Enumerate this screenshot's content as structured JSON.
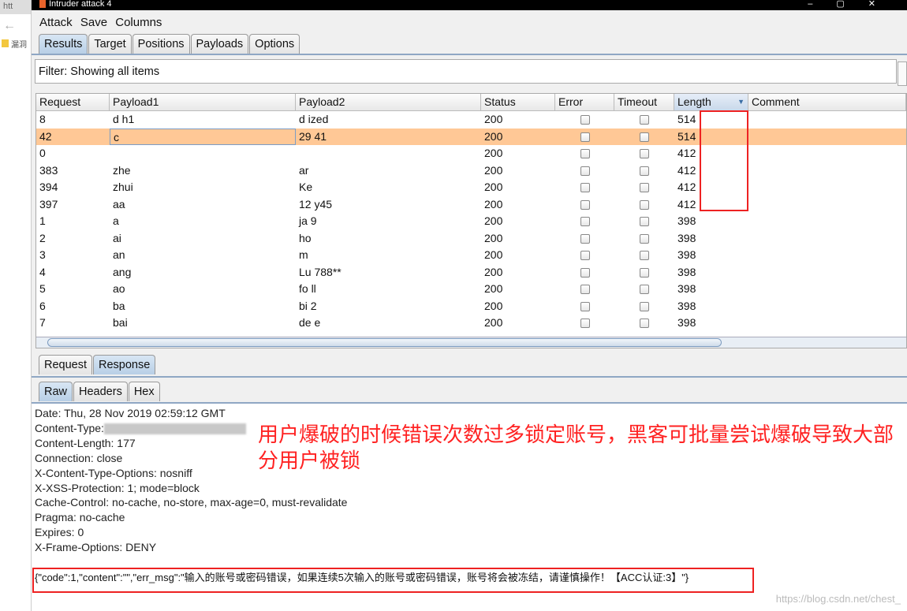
{
  "browser": {
    "tab_text": "htt",
    "bookmark": "漏洞"
  },
  "window": {
    "title": "Intruder attack 4"
  },
  "menu": [
    "Attack",
    "Save",
    "Columns"
  ],
  "tabs": [
    "Results",
    "Target",
    "Positions",
    "Payloads",
    "Options"
  ],
  "active_tab": "Results",
  "filter": "Filter: Showing all items",
  "columns": [
    "Request",
    "Payload1",
    "Payload2",
    "Status",
    "Error",
    "Timeout",
    "Length",
    "Comment"
  ],
  "rows": [
    {
      "request": "8",
      "payload1": "d h1",
      "payload2": "d ized",
      "status": "200",
      "length": "514"
    },
    {
      "request": "42",
      "payload1": "c",
      "payload2": "29 41",
      "status": "200",
      "length": "514",
      "selected": true
    },
    {
      "request": "0",
      "payload1": "",
      "payload2": "",
      "status": "200",
      "length": "412"
    },
    {
      "request": "383",
      "payload1": "zhe",
      "payload2": "ar",
      "status": "200",
      "length": "412"
    },
    {
      "request": "394",
      "payload1": "zhui",
      "payload2": "Ke",
      "status": "200",
      "length": "412"
    },
    {
      "request": "397",
      "payload1": "aa",
      "payload2": "12 y45",
      "status": "200",
      "length": "412"
    },
    {
      "request": "1",
      "payload1": "a",
      "payload2": "ja 9",
      "status": "200",
      "length": "398"
    },
    {
      "request": "2",
      "payload1": "ai",
      "payload2": "ho",
      "status": "200",
      "length": "398"
    },
    {
      "request": "3",
      "payload1": "an",
      "payload2": "m",
      "status": "200",
      "length": "398"
    },
    {
      "request": "4",
      "payload1": "ang",
      "payload2": "Lu 788**",
      "status": "200",
      "length": "398"
    },
    {
      "request": "5",
      "payload1": "ao",
      "payload2": "fo ll",
      "status": "200",
      "length": "398"
    },
    {
      "request": "6",
      "payload1": "ba",
      "payload2": "bi 2",
      "status": "200",
      "length": "398"
    },
    {
      "request": "7",
      "payload1": "bai",
      "payload2": "de e",
      "status": "200",
      "length": "398"
    }
  ],
  "detail_tabs": [
    "Request",
    "Response"
  ],
  "active_detail_tab": "Response",
  "view_tabs": [
    "Raw",
    "Headers",
    "Hex"
  ],
  "active_view_tab": "Raw",
  "response_headers": [
    "Date: Thu, 28 Nov 2019 02:59:12 GMT",
    "Content-Type:",
    "Content-Length: 177",
    "Connection: close",
    "X-Content-Type-Options: nosniff",
    "X-XSS-Protection: 1; mode=block",
    "Cache-Control: no-cache, no-store, max-age=0, must-revalidate",
    "Pragma: no-cache",
    "Expires: 0",
    "X-Frame-Options: DENY"
  ],
  "response_body": "{\"code\":1,\"content\":\"\",\"err_msg\":\"输入的账号或密码错误，如果连续5次输入的账号或密码错误，账号将会被冻结，请谨慎操作！【ACC认证:3】\"}",
  "annotation": "用户爆破的时候错误次数过多锁定账号，黑客可批量尝试爆破导致大部分用户被锁",
  "watermark": "https://blog.csdn.net/chest_",
  "colors": {
    "selected_row": "#ffc896",
    "annotation": "#ff2222",
    "tab_active": "#b8cfe6"
  }
}
